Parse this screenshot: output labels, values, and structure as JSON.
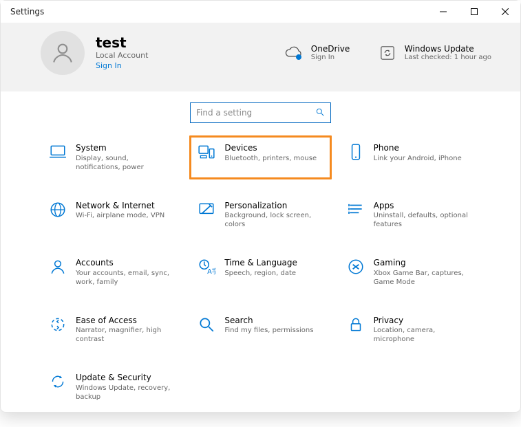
{
  "window": {
    "title": "Settings"
  },
  "header": {
    "user": {
      "name": "test",
      "account_type": "Local Account",
      "signin": "Sign In"
    },
    "widgets": [
      {
        "id": "onedrive",
        "title": "OneDrive",
        "sub": "Sign In"
      },
      {
        "id": "update",
        "title": "Windows Update",
        "sub": "Last checked: 1 hour ago"
      }
    ]
  },
  "search": {
    "placeholder": "Find a setting"
  },
  "categories": [
    {
      "id": "system",
      "title": "System",
      "desc": "Display, sound, notifications, power",
      "icon": "laptop-icon"
    },
    {
      "id": "devices",
      "title": "Devices",
      "desc": "Bluetooth, printers, mouse",
      "icon": "devices-icon",
      "highlight": true
    },
    {
      "id": "phone",
      "title": "Phone",
      "desc": "Link your Android, iPhone",
      "icon": "phone-icon"
    },
    {
      "id": "network",
      "title": "Network & Internet",
      "desc": "Wi-Fi, airplane mode, VPN",
      "icon": "globe-icon"
    },
    {
      "id": "personalize",
      "title": "Personalization",
      "desc": "Background, lock screen, colors",
      "icon": "personalize-icon"
    },
    {
      "id": "apps",
      "title": "Apps",
      "desc": "Uninstall, defaults, optional features",
      "icon": "apps-icon"
    },
    {
      "id": "accounts",
      "title": "Accounts",
      "desc": "Your accounts, email, sync, work, family",
      "icon": "person-icon"
    },
    {
      "id": "time",
      "title": "Time & Language",
      "desc": "Speech, region, date",
      "icon": "time-language-icon"
    },
    {
      "id": "gaming",
      "title": "Gaming",
      "desc": "Xbox Game Bar, captures, Game Mode",
      "icon": "gaming-icon"
    },
    {
      "id": "ease",
      "title": "Ease of Access",
      "desc": "Narrator, magnifier, high contrast",
      "icon": "ease-icon"
    },
    {
      "id": "search",
      "title": "Search",
      "desc": "Find my files, permissions",
      "icon": "search-icon"
    },
    {
      "id": "privacy",
      "title": "Privacy",
      "desc": "Location, camera, microphone",
      "icon": "lock-icon"
    },
    {
      "id": "update",
      "title": "Update & Security",
      "desc": "Windows Update, recovery, backup",
      "icon": "sync-icon"
    }
  ]
}
